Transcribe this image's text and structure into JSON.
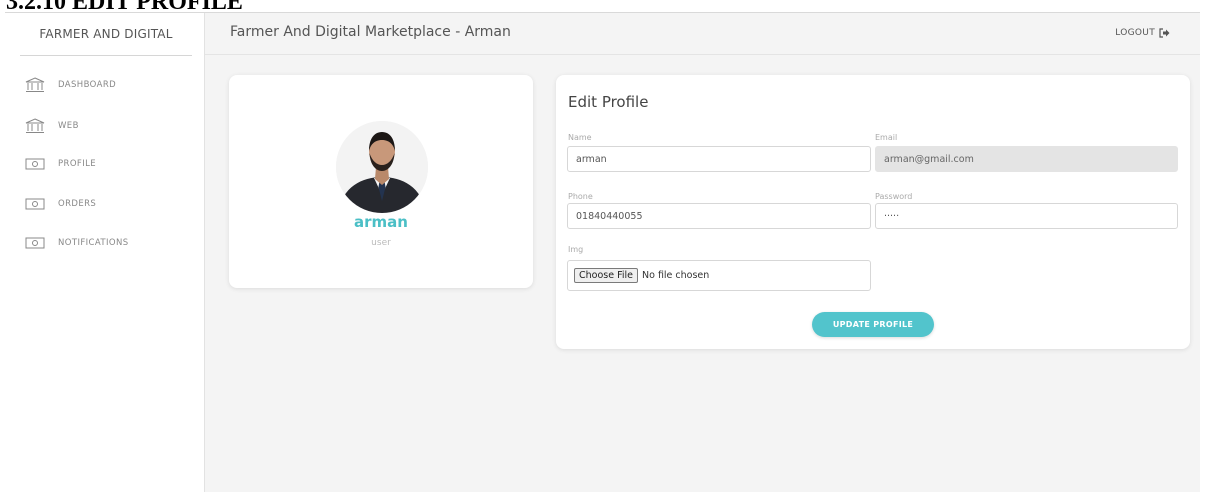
{
  "document": {
    "heading": "3.2.10 EDIT PROFILE"
  },
  "sidebar": {
    "brand": "FARMER AND DIGITAL",
    "items": [
      {
        "label": "DASHBOARD",
        "icon": "bank-icon"
      },
      {
        "label": "WEB",
        "icon": "bank-icon"
      },
      {
        "label": "PROFILE",
        "icon": "money-icon"
      },
      {
        "label": "ORDERS",
        "icon": "money-icon"
      },
      {
        "label": "NOTIFICATIONS",
        "icon": "money-icon"
      }
    ]
  },
  "topbar": {
    "title": "Farmer And Digital Marketplace - Arman",
    "logout_label": "LOGOUT",
    "logout_icon": "sign-out-icon"
  },
  "profile_card": {
    "name": "arman",
    "role": "user"
  },
  "edit_profile": {
    "title": "Edit Profile",
    "name_label": "Name",
    "name_value": "arman",
    "email_label": "Email",
    "email_value": "arman@gmail.com",
    "phone_label": "Phone",
    "phone_value": "01840440055",
    "password_label": "Password",
    "password_value": "·····",
    "img_label": "Img",
    "file_button": "Choose File",
    "file_status": "No file chosen",
    "submit_label": "UPDATE PROFILE"
  },
  "colors": {
    "accent": "#4bbfc6",
    "button": "#52c4cc",
    "background": "#f4f4f4"
  }
}
